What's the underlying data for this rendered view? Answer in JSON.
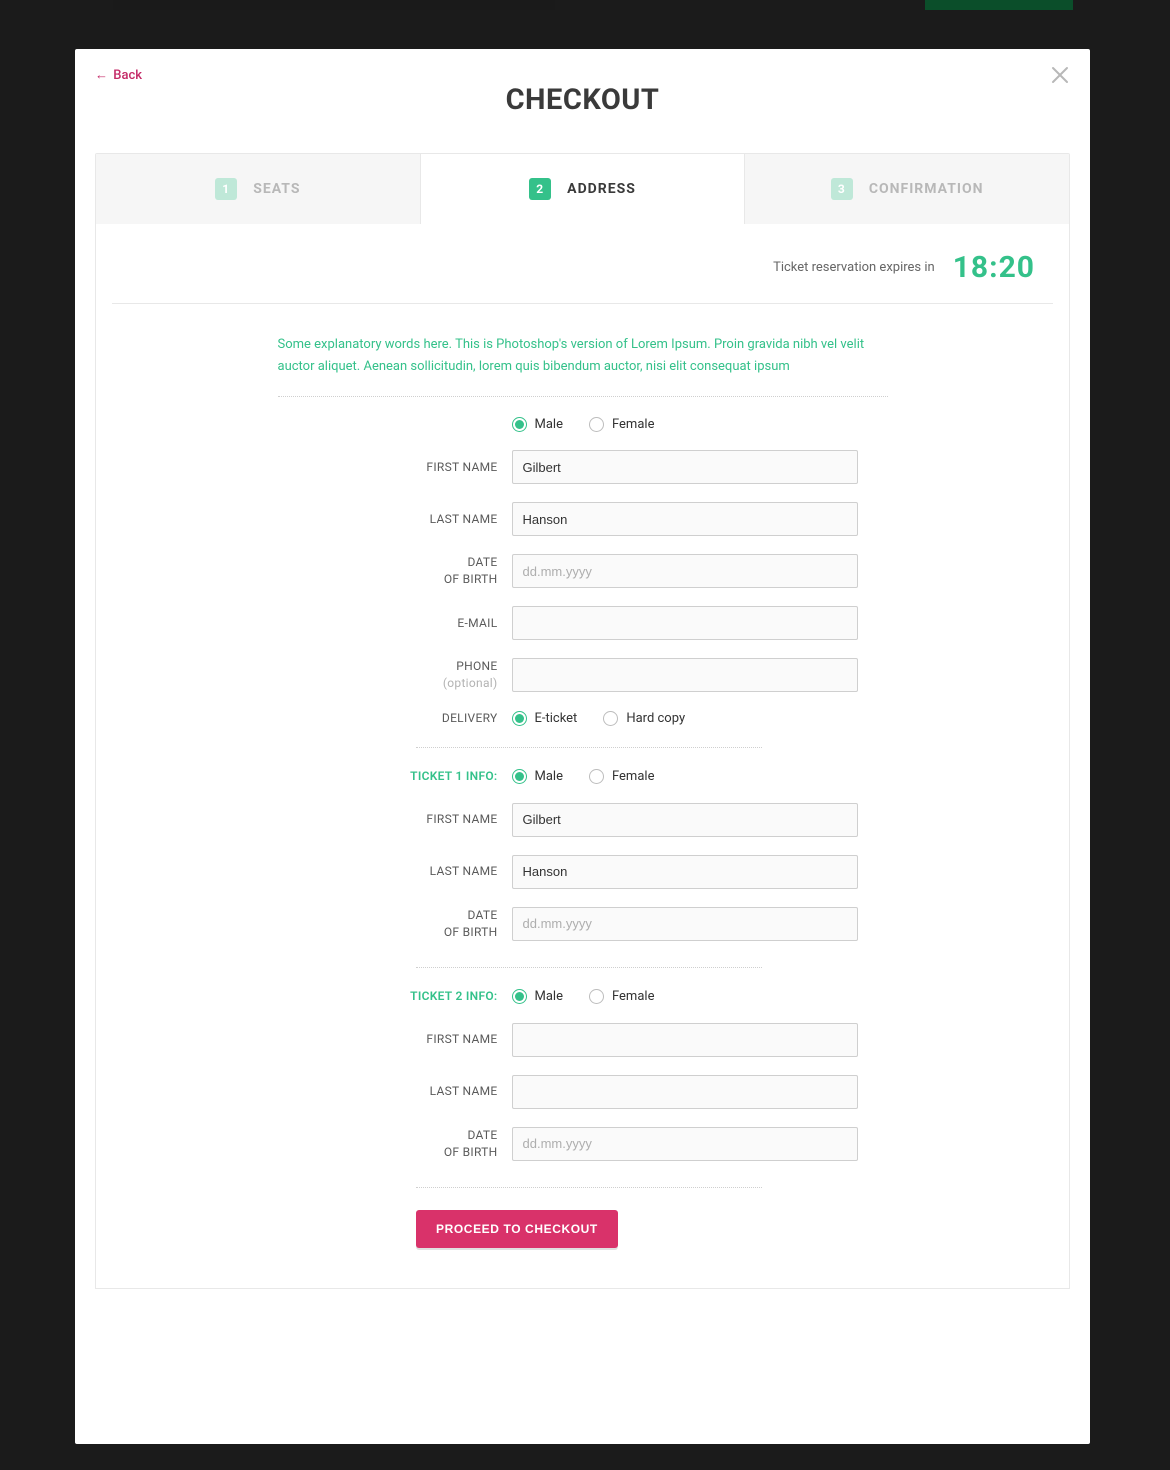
{
  "header": {
    "back_label": "Back",
    "title": "CHECKOUT"
  },
  "steps": [
    {
      "num": "1",
      "label": "SEATS",
      "active": false
    },
    {
      "num": "2",
      "label": "ADDRESS",
      "active": true
    },
    {
      "num": "3",
      "label": "CONFIRMATION",
      "active": false
    }
  ],
  "timer": {
    "label": "Ticket reservation expires in",
    "value": "18:20"
  },
  "intro_text": "Some explanatory words here. This is Photoshop's version  of Lorem Ipsum. Proin gravida nibh vel velit auctor aliquet. Aenean sollicitudin, lorem quis bibendum auctor, nisi elit consequat ipsum",
  "labels": {
    "male": "Male",
    "female": "Female",
    "first_name": "FIRST NAME",
    "last_name": "LAST NAME",
    "date_of_birth_l1": "DATE",
    "date_of_birth_l2": "OF BIRTH",
    "email": "E-MAIL",
    "phone": "PHONE",
    "phone_optional": "(optional)",
    "delivery": "DELIVERY",
    "eticket": "E-ticket",
    "hardcopy": "Hard copy",
    "ticket1": "TICKET 1 INFO:",
    "ticket2": "TICKET 2 INFO:"
  },
  "placeholders": {
    "dob": "dd.mm.yyyy"
  },
  "main_form": {
    "gender": "male",
    "first_name": "Gilbert",
    "last_name": "Hanson",
    "dob": "",
    "email": "",
    "phone": "",
    "delivery": "eticket"
  },
  "ticket1": {
    "gender": "male",
    "first_name": "Gilbert",
    "last_name": "Hanson",
    "dob": ""
  },
  "ticket2": {
    "gender": "male",
    "first_name": "",
    "last_name": "",
    "dob": ""
  },
  "submit": {
    "label": "PROCEED TO CHECKOUT"
  }
}
